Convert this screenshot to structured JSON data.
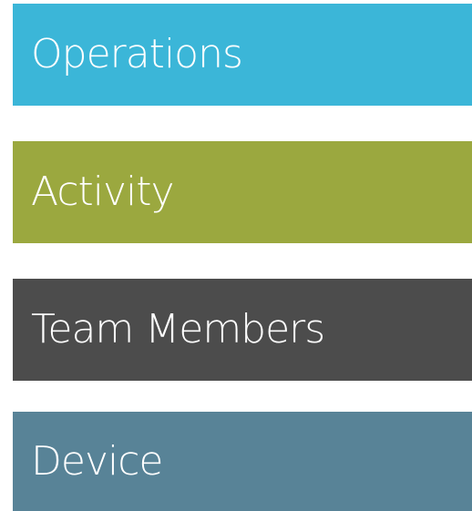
{
  "tiles": [
    {
      "label": "Operations",
      "color": "#3bb6d8"
    },
    {
      "label": "Activity",
      "color": "#9ba83f"
    },
    {
      "label": "Team Members",
      "color": "#4c4c4c"
    },
    {
      "label": "Device",
      "color": "#588397"
    }
  ]
}
